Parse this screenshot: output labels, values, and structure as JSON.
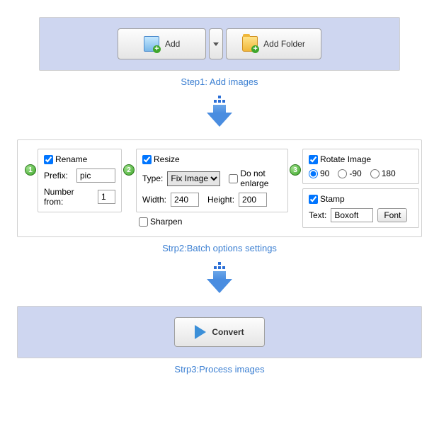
{
  "step1": {
    "add_label": "Add",
    "add_folder_label": "Add Folder",
    "caption": "Step1: Add images"
  },
  "step2": {
    "rename": {
      "checkbox_label": "Rename",
      "prefix_label": "Prefix:",
      "prefix_value": "pic",
      "number_from_label": "Number from:",
      "number_from_value": "1"
    },
    "resize": {
      "checkbox_label": "Resize",
      "type_label": "Type:",
      "type_value": "Fix Image",
      "do_not_enlarge_label": "Do not enlarge",
      "width_label": "Width:",
      "width_value": "240",
      "height_label": "Height:",
      "height_value": "200"
    },
    "sharpen_label": "Sharpen",
    "rotate": {
      "checkbox_label": "Rotate Image",
      "opt_90": "90",
      "opt_neg90": "-90",
      "opt_180": "180",
      "selected": "90"
    },
    "stamp": {
      "checkbox_label": "Stamp",
      "text_label": "Text:",
      "text_value": "Boxoft",
      "font_button": "Font"
    },
    "caption": "Strp2:Batch options settings"
  },
  "step3": {
    "convert_label": "Convert",
    "caption": "Strp3:Process images"
  },
  "badges": {
    "b1": "1",
    "b2": "2",
    "b3": "3"
  }
}
